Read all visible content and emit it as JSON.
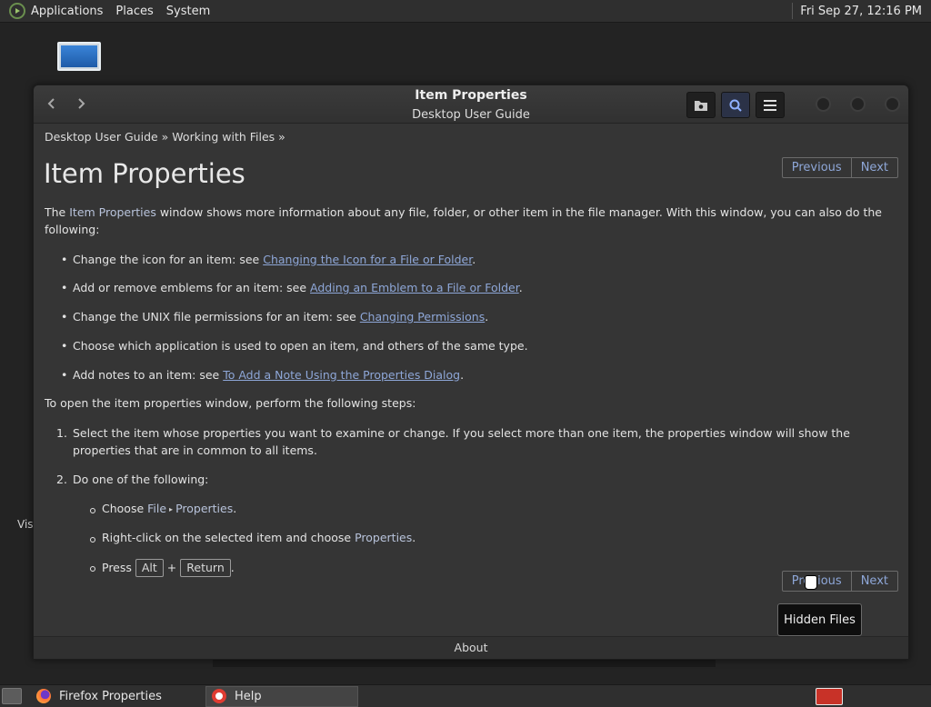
{
  "top_panel": {
    "menus": [
      "Applications",
      "Places",
      "System"
    ],
    "clock": "Fri Sep 27, 12:16 PM"
  },
  "desktop": {
    "partial_label": "Vis"
  },
  "window": {
    "title": "Item Properties",
    "subtitle": "Desktop User Guide",
    "breadcrumb": "Desktop User Guide » Working with Files »",
    "page_title": "Item Properties",
    "pager": {
      "previous": "Previous",
      "next": "Next"
    },
    "intro": {
      "before": "The ",
      "gui": "Item Properties",
      "after": " window shows more information about any file, folder, or other item in the file manager. With this window, you can also do the following:"
    },
    "bullets": [
      {
        "text": "Change the icon for an item: see ",
        "link": "Changing the Icon for a File or Folder",
        "tail": "."
      },
      {
        "text": "Add or remove emblems for an item: see ",
        "link": "Adding an Emblem to a File or Folder",
        "tail": "."
      },
      {
        "text": "Change the UNIX file permissions for an item: see ",
        "link": "Changing Permissions",
        "tail": "."
      },
      {
        "text": "Choose which application is used to open an item, and others of the same type.",
        "link": "",
        "tail": ""
      },
      {
        "text": "Add notes to an item: see ",
        "link": "To Add a Note Using the Properties Dialog",
        "tail": "."
      }
    ],
    "steps_intro": "To open the item properties window, perform the following steps:",
    "steps": [
      {
        "num": "1.",
        "text": "Select the item whose properties you want to examine or change. If you select more than one item, the properties window will show the properties that are in common to all items."
      },
      {
        "num": "2.",
        "text": "Do one of the following:"
      }
    ],
    "substeps": {
      "choose_prefix": "Choose ",
      "menu_file": "File",
      "menu_arrow": "▸",
      "menu_properties": "Properties",
      "choose_suffix": ".",
      "rightclick_prefix": "Right-click on the selected item and choose ",
      "rightclick_gui": "Properties",
      "rightclick_suffix": ".",
      "press_prefix": "Press ",
      "key_alt": "Alt",
      "plus": "+",
      "key_return": "Return",
      "press_suffix": "."
    },
    "tooltip": "Hidden Files",
    "footer": "About"
  },
  "taskbar": {
    "tasks": [
      {
        "label": "Firefox Properties",
        "icon": "firefox-icon"
      },
      {
        "label": "Help",
        "icon": "help-icon"
      }
    ]
  }
}
